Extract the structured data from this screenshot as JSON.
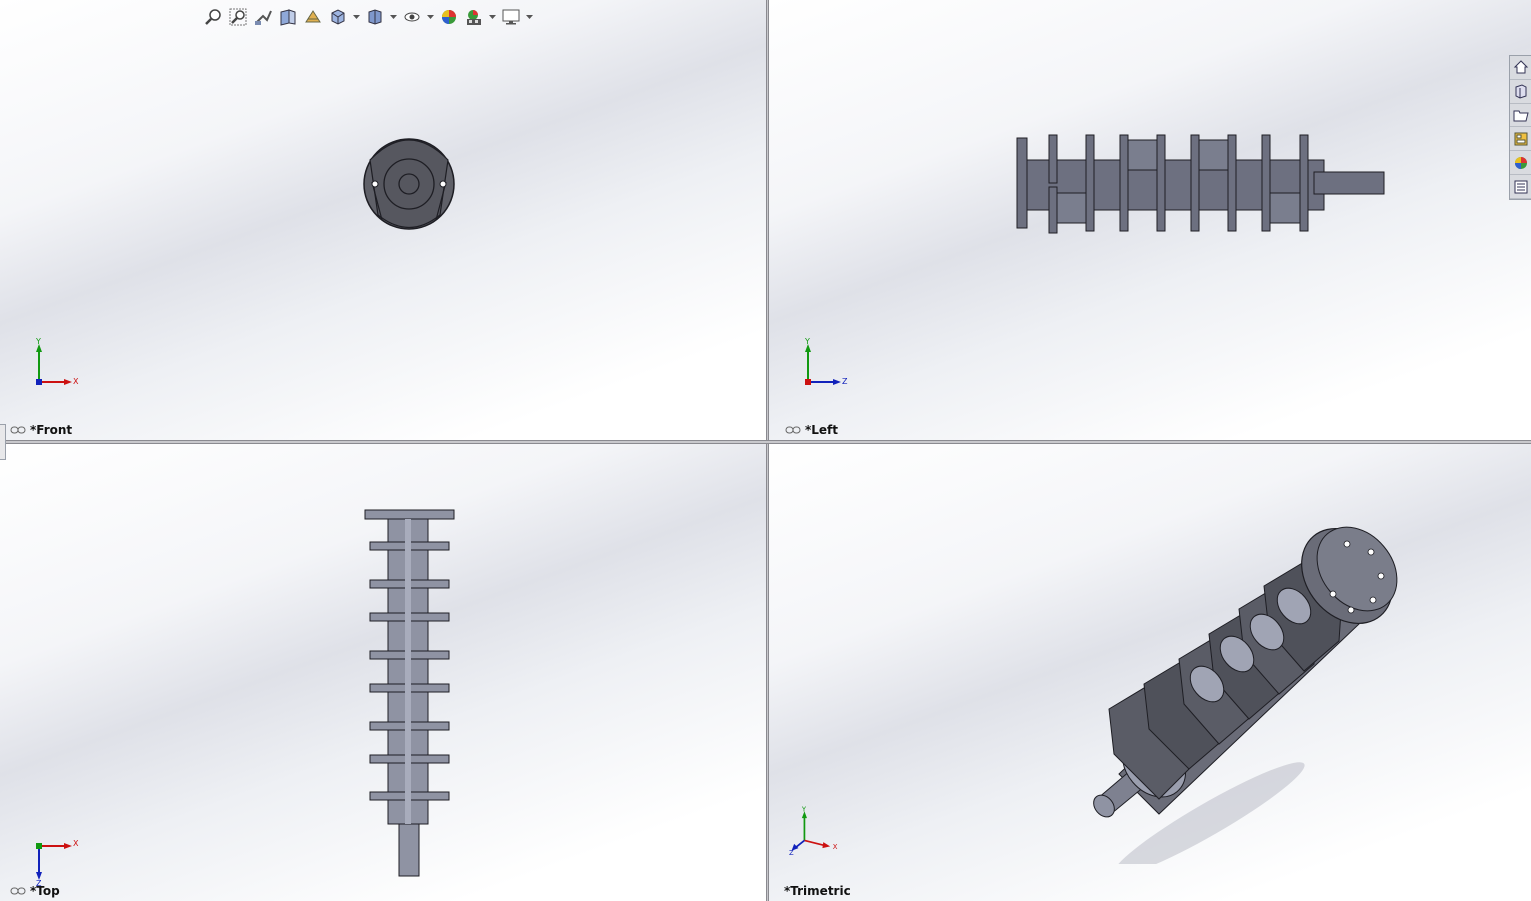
{
  "viewports": {
    "front": {
      "label": "*Front",
      "axes": {
        "h": "X",
        "v": "Y"
      }
    },
    "left": {
      "label": "*Left",
      "axes": {
        "h": "Z",
        "v": "Y"
      }
    },
    "top": {
      "label": "*Top",
      "axes": {
        "h": "X",
        "v": "Z"
      }
    },
    "trimetric": {
      "label": "*Trimetric",
      "axes": {
        "h": "X",
        "v": "Y",
        "d": "Z"
      }
    }
  },
  "heads_up_toolbar": {
    "items": [
      "zoom-to-fit-icon",
      "zoom-to-area-icon",
      "previous-view-icon",
      "section-view-icon",
      "dynamic-annotation-icon",
      "view-orientation-icon",
      "display-style-icon",
      "hide-show-items-icon",
      "edit-appearance-icon",
      "apply-scene-icon",
      "view-settings-icon"
    ]
  },
  "task_pane": {
    "items": [
      "solidworks-resources-icon",
      "design-library-icon",
      "file-explorer-icon",
      "view-palette-icon",
      "appearances-scenes-icon",
      "custom-properties-icon"
    ]
  },
  "colors": {
    "model_face": "#5f6068",
    "model_edge": "#1e1e24",
    "model_light": "#8f93a3",
    "axis_x": "#cc1111",
    "axis_y": "#119911",
    "axis_z": "#1122bb"
  }
}
